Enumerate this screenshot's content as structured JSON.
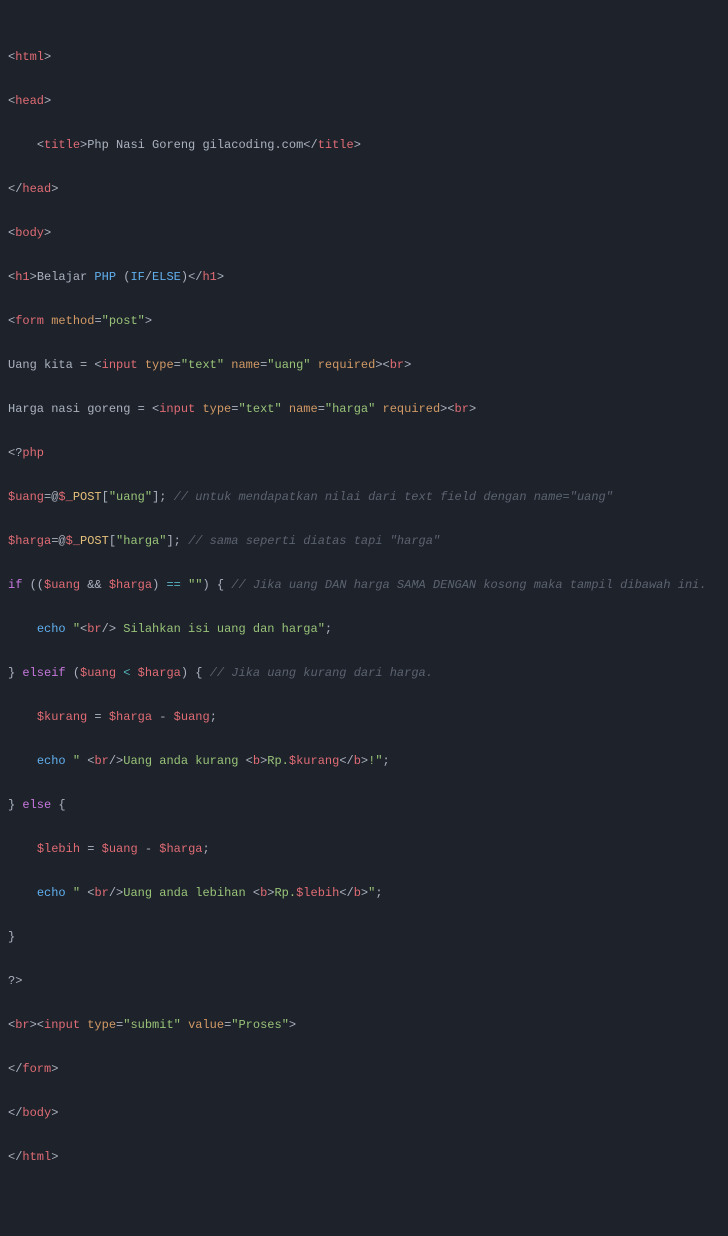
{
  "line01": {
    "a": "<",
    "b": "html",
    "c": ">"
  },
  "line02": {
    "a": "<",
    "b": "head",
    "c": ">"
  },
  "line03": {
    "a": "<",
    "b": "title",
    "c": ">",
    "d": "Php Nasi Goreng gilacoding.com",
    "e": "</",
    "f": "title",
    "g": ">"
  },
  "line04": {
    "a": "</",
    "b": "head",
    "c": ">"
  },
  "line05": {
    "a": "<",
    "b": "body",
    "c": ">"
  },
  "line06": {
    "a": "<",
    "b": "h1",
    "c": ">",
    "d": "Belajar ",
    "e": "PHP",
    "f": " (",
    "g": "IF",
    "h": "/",
    "i": "ELSE",
    "j": ")",
    "k": "</",
    "l": "h1",
    "m": ">"
  },
  "line07": {
    "a": "<",
    "b": "form",
    "c": "method",
    "d": "=",
    "e": "\"post\"",
    "f": ">"
  },
  "line08": {
    "a": "Uang kita = ",
    "b": "<",
    "c": "input",
    "d": "type",
    "e": "=",
    "f": "\"text\"",
    "g": "name",
    "h": "=",
    "i": "\"uang\"",
    "j": "required",
    "k": "><",
    "l": "br",
    "m": ">"
  },
  "line09": {
    "a": "Harga nasi goreng = ",
    "b": "<",
    "c": "input",
    "d": "type",
    "e": "=",
    "f": "\"text\"",
    "g": "name",
    "h": "=",
    "i": "\"harga\"",
    "j": "required",
    "k": "><",
    "l": "br",
    "m": ">"
  },
  "line10": {
    "a": "<?",
    "b": "php"
  },
  "line11": {
    "a": "$uang",
    "b": "=@",
    "c": "$_",
    "d": "POST",
    "e": "[",
    "f": "\"uang\"",
    "g": "]; ",
    "h": "// untuk mendapatkan nilai dari text field dengan name=\"uang\""
  },
  "line12": {
    "a": "$harga",
    "b": "=@",
    "c": "$_",
    "d": "POST",
    "e": "[",
    "f": "\"harga\"",
    "g": "]; ",
    "h": "// sama seperti diatas tapi \"harga\""
  },
  "line13": {
    "a": "if",
    "b": " ((",
    "c": "$uang",
    "d": " && ",
    "e": "$harga",
    "f": ") ",
    "g": "==",
    "h": " ",
    "i": "\"\"",
    "j": ") { ",
    "k": "// Jika uang DAN harga SAMA DENGAN kosong maka tampil dibawah ini."
  },
  "line14": {
    "a": "echo",
    "b": " ",
    "c": "\"",
    "d": "<",
    "e": "br",
    "f": "/>",
    "g": " Silahkan isi uang dan harga",
    "h": "\"",
    "i": ";"
  },
  "line15": {
    "a": "} ",
    "b": "elseif",
    "c": " (",
    "d": "$uang",
    "e": " ",
    "f": "<",
    "g": " ",
    "h": "$harga",
    "i": ") { ",
    "j": "// Jika uang kurang dari harga."
  },
  "line16": {
    "a": "$kurang",
    "b": " = ",
    "c": "$harga",
    "d": " - ",
    "e": "$uang",
    "f": ";"
  },
  "line17": {
    "a": "echo",
    "b": " ",
    "c": "\" ",
    "d": "<",
    "e": "br",
    "f": "/>",
    "g": "Uang anda kurang ",
    "h": "<",
    "i": "b",
    "j": ">",
    "k": "Rp.",
    "l": "$kurang",
    "m": "</",
    "n": "b",
    "o": ">",
    "p": "!",
    "q": "\"",
    "r": ";"
  },
  "line18": {
    "a": "} ",
    "b": "else",
    "c": " {"
  },
  "line19": {
    "a": "$lebih",
    "b": " = ",
    "c": "$uang",
    "d": " - ",
    "e": "$harga",
    "f": ";"
  },
  "line20": {
    "a": "echo",
    "b": " ",
    "c": "\" ",
    "d": "<",
    "e": "br",
    "f": "/>",
    "g": "Uang anda lebihan ",
    "h": "<",
    "i": "b",
    "j": ">",
    "k": "Rp.",
    "l": "$lebih",
    "m": "</",
    "n": "b",
    "o": ">",
    "p": "\"",
    "q": ";"
  },
  "line21": {
    "a": "}"
  },
  "line22": {
    "a": "?>"
  },
  "line23": {
    "a": "<",
    "b": "br",
    "c": "><",
    "d": "input",
    "e": "type",
    "f": "=",
    "g": "\"submit\"",
    "h": "value",
    "i": "=",
    "j": "\"Proses\"",
    "k": ">"
  },
  "line24": {
    "a": "</",
    "b": "form",
    "c": ">"
  },
  "line25": {
    "a": "</",
    "b": "body",
    "c": ">"
  },
  "line26": {
    "a": "</",
    "b": "html",
    "c": ">"
  }
}
